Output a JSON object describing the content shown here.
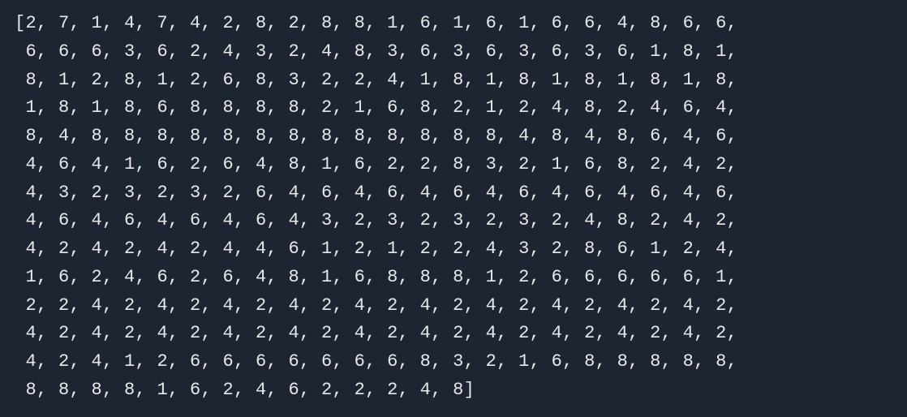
{
  "terminal": {
    "output_prefix": "[",
    "output_suffix": "]",
    "array_values": [
      2,
      7,
      1,
      4,
      7,
      4,
      2,
      8,
      2,
      8,
      8,
      1,
      6,
      1,
      6,
      1,
      6,
      6,
      4,
      8,
      6,
      6,
      6,
      6,
      6,
      3,
      6,
      2,
      4,
      3,
      2,
      4,
      8,
      3,
      6,
      3,
      6,
      3,
      6,
      3,
      6,
      1,
      8,
      1,
      8,
      1,
      2,
      8,
      1,
      2,
      6,
      8,
      3,
      2,
      2,
      4,
      1,
      8,
      1,
      8,
      1,
      8,
      1,
      8,
      1,
      8,
      1,
      8,
      1,
      8,
      6,
      8,
      8,
      8,
      8,
      2,
      1,
      6,
      8,
      2,
      1,
      2,
      4,
      8,
      2,
      4,
      6,
      4,
      8,
      4,
      8,
      8,
      8,
      8,
      8,
      8,
      8,
      8,
      8,
      8,
      8,
      8,
      8,
      4,
      8,
      4,
      8,
      6,
      4,
      6,
      4,
      6,
      4,
      1,
      6,
      2,
      6,
      4,
      8,
      1,
      6,
      2,
      2,
      8,
      3,
      2,
      1,
      6,
      8,
      2,
      4,
      2,
      4,
      3,
      2,
      3,
      2,
      3,
      2,
      6,
      4,
      6,
      4,
      6,
      4,
      6,
      4,
      6,
      4,
      6,
      4,
      6,
      4,
      6,
      4,
      6,
      4,
      6,
      4,
      6,
      4,
      6,
      4,
      3,
      2,
      3,
      2,
      3,
      2,
      3,
      2,
      4,
      8,
      2,
      4,
      2,
      4,
      2,
      4,
      2,
      4,
      2,
      4,
      4,
      6,
      1,
      2,
      1,
      2,
      2,
      4,
      3,
      2,
      8,
      6,
      1,
      2,
      4,
      1,
      6,
      2,
      4,
      6,
      2,
      6,
      4,
      8,
      1,
      6,
      8,
      8,
      8,
      1,
      2,
      6,
      6,
      6,
      6,
      6,
      1,
      2,
      2,
      4,
      2,
      4,
      2,
      4,
      2,
      4,
      2,
      4,
      2,
      4,
      2,
      4,
      2,
      4,
      2,
      4,
      2,
      4,
      2,
      4,
      2,
      4,
      2,
      4,
      2,
      4,
      2,
      4,
      2,
      4,
      2,
      4,
      2,
      4,
      2,
      4,
      2,
      4,
      2,
      4,
      2,
      4,
      2,
      4,
      1,
      2,
      6,
      6,
      6,
      6,
      6,
      6,
      6,
      8,
      3,
      2,
      1,
      6,
      8,
      8,
      8,
      8,
      8,
      8,
      8,
      8,
      8,
      1,
      6,
      2,
      4,
      6,
      2,
      2,
      2,
      4,
      8
    ],
    "values_per_line": 22,
    "prompt_indicator": ""
  }
}
